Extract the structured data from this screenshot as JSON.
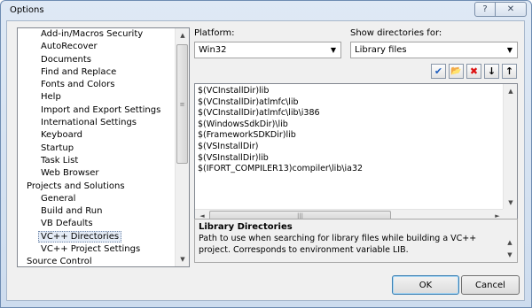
{
  "window": {
    "title": "Options"
  },
  "titlebar": {
    "help_glyph": "?",
    "close_glyph": "✕"
  },
  "tree": {
    "items": [
      {
        "label": "Add-in/Macros Security",
        "level": 1
      },
      {
        "label": "AutoRecover",
        "level": 1
      },
      {
        "label": "Documents",
        "level": 1
      },
      {
        "label": "Find and Replace",
        "level": 1
      },
      {
        "label": "Fonts and Colors",
        "level": 1
      },
      {
        "label": "Help",
        "level": 1
      },
      {
        "label": "Import and Export Settings",
        "level": 1
      },
      {
        "label": "International Settings",
        "level": 1
      },
      {
        "label": "Keyboard",
        "level": 1
      },
      {
        "label": "Startup",
        "level": 1
      },
      {
        "label": "Task List",
        "level": 1
      },
      {
        "label": "Web Browser",
        "level": 1
      },
      {
        "label": "Projects and Solutions",
        "level": 0
      },
      {
        "label": "General",
        "level": 1
      },
      {
        "label": "Build and Run",
        "level": 1
      },
      {
        "label": "VB Defaults",
        "level": 1
      },
      {
        "label": "VC++ Directories",
        "level": 1,
        "selected": true
      },
      {
        "label": "VC++ Project Settings",
        "level": 1
      },
      {
        "label": "Source Control",
        "level": 0
      }
    ]
  },
  "platform": {
    "label": "Platform:",
    "value": "Win32"
  },
  "show_dirs": {
    "label": "Show directories for:",
    "value": "Library files"
  },
  "toolbar": {
    "check_icon": "✔",
    "newfolder_icon": "📂",
    "delete_icon": "✖",
    "down_icon": "↓",
    "up_icon": "↑"
  },
  "dirs": [
    "$(VCInstallDir)lib",
    "$(VCInstallDir)atlmfc\\lib",
    "$(VCInstallDir)atlmfc\\lib\\i386",
    "$(WindowsSdkDir)\\lib",
    "$(FrameworkSDKDir)lib",
    "$(VSInstallDir)",
    "$(VSInstallDir)lib",
    "$(IFORT_COMPILER13)compiler\\lib\\ia32"
  ],
  "description": {
    "title": "Library Directories",
    "text": "Path to use when searching for library files while building a VC++ project. Corresponds to environment variable LIB."
  },
  "buttons": {
    "ok": "OK",
    "cancel": "Cancel"
  },
  "scroll": {
    "up": "▲",
    "down": "▼",
    "left": "◄",
    "right": "►",
    "grip_v": "≡",
    "grip_h": "|||"
  }
}
